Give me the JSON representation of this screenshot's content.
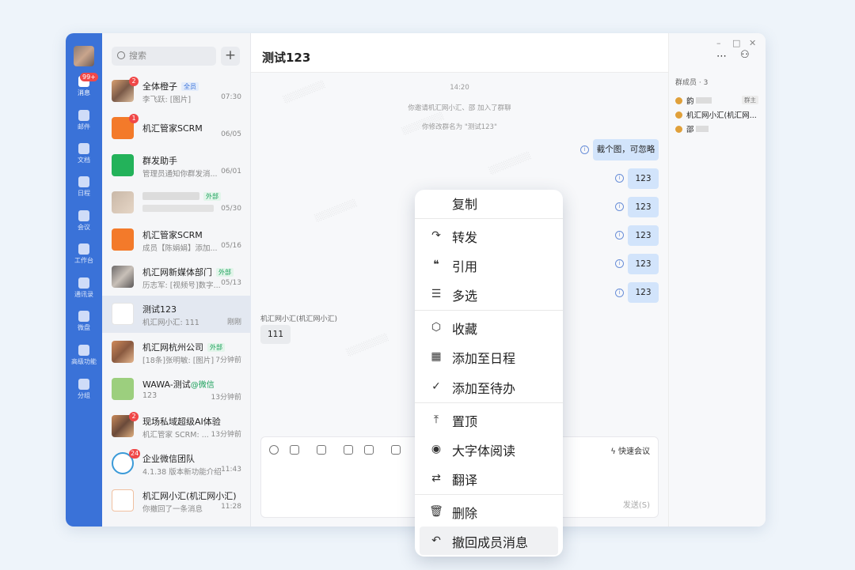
{
  "rail": {
    "badge": "99+",
    "items": [
      "消息",
      "邮件",
      "文档",
      "日程",
      "会议",
      "工作台",
      "通讯录",
      "微盘",
      "高级功能",
      "分组"
    ]
  },
  "list": {
    "search_placeholder": "搜索",
    "add": "+",
    "conversations": [
      {
        "name": "全体橙子",
        "tag": "全员",
        "tag_color": "blue",
        "msg": "李飞跃: [图片]",
        "time": "07:30",
        "badge": "2"
      },
      {
        "name": "机汇管家SCRM",
        "tag": "",
        "tag_color": "",
        "msg": "",
        "time": "06/05",
        "badge": "1"
      },
      {
        "name": "群发助手",
        "tag": "",
        "tag_color": "",
        "msg": "管理员通知你群发消...",
        "time": "06/01",
        "badge": ""
      },
      {
        "name": "",
        "tag": "外部",
        "tag_color": "green",
        "msg": "",
        "time": "05/30",
        "badge": ""
      },
      {
        "name": "机汇管家SCRM",
        "tag": "",
        "tag_color": "",
        "msg": "成员【陈娟娟】添加...",
        "time": "05/16",
        "badge": ""
      },
      {
        "name": "机汇网新媒体部门",
        "tag": "外部",
        "tag_color": "green",
        "msg": "历志军: [视频号]数字...",
        "time": "05/13",
        "badge": ""
      },
      {
        "name": "测试123",
        "tag": "",
        "tag_color": "",
        "msg": "机汇网小汇: 111",
        "time": "刚刚",
        "badge": ""
      },
      {
        "name": "机汇网杭州公司",
        "tag": "外部",
        "tag_color": "green",
        "msg": "[18条]张明敏: [图片]",
        "time": "7分钟前",
        "badge": ""
      },
      {
        "name": "WAWA-测试",
        "tag": "@微信",
        "tag_color": "green",
        "msg": "123",
        "time": "13分钟前",
        "badge": ""
      },
      {
        "name": "现场私域超级AI体验",
        "tag": "",
        "tag_color": "",
        "msg": "机汇管家 SCRM: ...",
        "time": "13分钟前",
        "badge": "2"
      },
      {
        "name": "企业微信团队",
        "tag": "",
        "tag_color": "",
        "msg": "4.1.38 版本新功能介绍",
        "time": "11:43",
        "badge": "24"
      },
      {
        "name": "机汇网小汇(机汇网小汇)",
        "tag": "",
        "tag_color": "",
        "msg": "你撤回了一条消息",
        "time": "11:28",
        "badge": ""
      }
    ]
  },
  "chat": {
    "title": "测试123",
    "time": "14:20",
    "sys1": "你邀请机汇网小汇、邵    加入了群聊",
    "sys2": "你修改群名为 \"测试123\"",
    "out_messages": [
      "截个图，可忽略",
      "123",
      "123",
      "123",
      "123",
      "123"
    ],
    "incoming_name": "机汇网小汇(机汇网小汇)",
    "incoming_text": "111",
    "quick_meeting": "快速会议",
    "send": "发送(S)"
  },
  "members": {
    "header": "群成员 · 3",
    "owner_tag": "群主",
    "list": [
      "韵",
      "机汇网小汇(机汇网...",
      "邵"
    ]
  },
  "menu": {
    "items": [
      {
        "icon": "copy-icon",
        "glyph": "",
        "label": "复制"
      },
      {
        "icon": "forward-icon",
        "glyph": "↷",
        "label": "转发"
      },
      {
        "icon": "quote-icon",
        "glyph": "❝",
        "label": "引用"
      },
      {
        "icon": "multi-select-icon",
        "glyph": "☰",
        "label": "多选"
      },
      {
        "icon": "favorite-icon",
        "glyph": "⬡",
        "label": "收藏"
      },
      {
        "icon": "calendar-icon",
        "glyph": "▦",
        "label": "添加至日程"
      },
      {
        "icon": "todo-icon",
        "glyph": "✓",
        "label": "添加至待办"
      },
      {
        "icon": "pin-icon",
        "glyph": "⤒",
        "label": "置顶"
      },
      {
        "icon": "eye-icon",
        "glyph": "◉",
        "label": "大字体阅读"
      },
      {
        "icon": "translate-icon",
        "glyph": "⇄",
        "label": "翻译"
      },
      {
        "icon": "delete-icon",
        "glyph": "🗑",
        "label": "删除"
      },
      {
        "icon": "recall-icon",
        "glyph": "↶",
        "label": "撤回成员消息"
      }
    ]
  }
}
